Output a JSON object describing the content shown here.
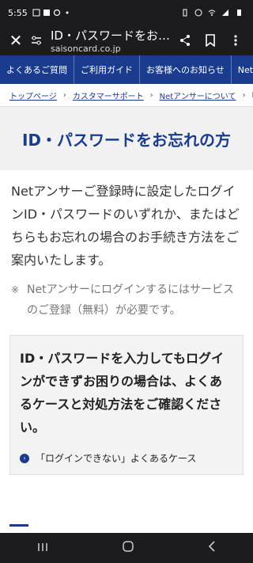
{
  "status_bar": {
    "time": "5:55"
  },
  "browser": {
    "page_title": "ID・パスワードをお…",
    "url": "saisoncard.co.jp"
  },
  "nav": {
    "items": [
      "よくあるご質問",
      "ご利用ガイド",
      "お客様へのお知らせ",
      "Net"
    ]
  },
  "breadcrumb": {
    "items": [
      "トップページ",
      "カスタマーサポート",
      "Netアンサーについて",
      "ID"
    ]
  },
  "page": {
    "title": "ID・パスワードをお忘れの方",
    "intro": "Netアンサーご登録時に設定したログインID・パスワードのいずれか、またはどちらもお忘れの場合のお手続き方法をご案内いたします。",
    "note_mark": "※",
    "note": "Netアンサーにログインするにはサービスのご登録（無料）が必要です。"
  },
  "help_box": {
    "heading": "ID・パスワードを入力してもログインができずお困りの場合は、よくあるケースと対処方法をご確認ください。",
    "link_label": "「ログインできない」よくあるケース"
  },
  "colors": {
    "brand": "#1a3c8f",
    "hero_bg": "#f1f1f1",
    "box_bg": "#f3f3f3"
  }
}
